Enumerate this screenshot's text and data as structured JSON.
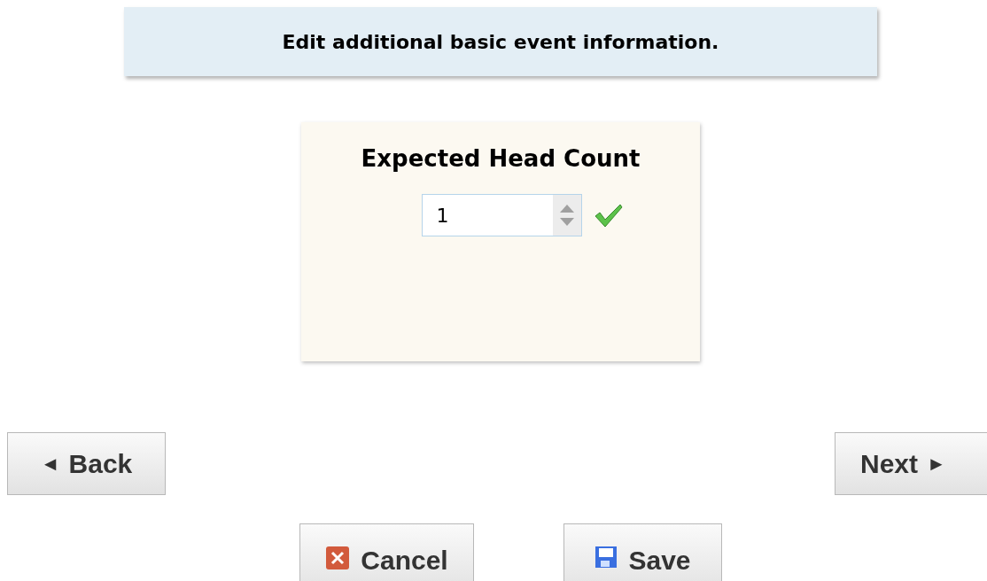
{
  "banner": {
    "text": "Edit additional basic event information."
  },
  "field": {
    "label": "Expected Head Count",
    "value": "1",
    "valid": true
  },
  "navigation": [
    {
      "kind": "back",
      "arrow": "◄",
      "label": "Back"
    },
    {
      "kind": "next",
      "arrow": "►",
      "label": "Next"
    }
  ],
  "actions": [
    {
      "kind": "cancel",
      "label": "Cancel"
    },
    {
      "kind": "save",
      "label": "Save"
    }
  ]
}
